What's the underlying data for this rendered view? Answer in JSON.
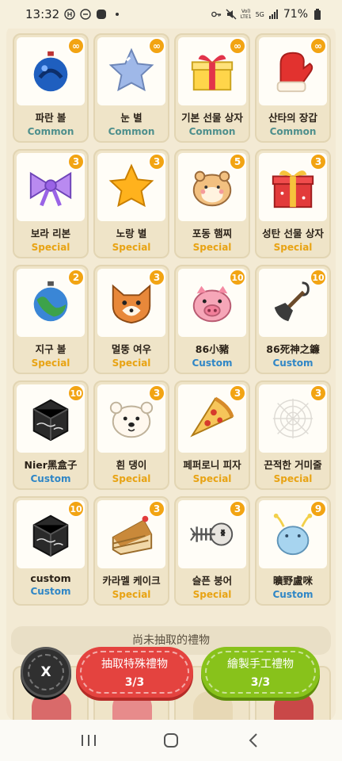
{
  "status": {
    "time": "13:32",
    "battery": "71%",
    "net_a": "Vol)",
    "net_b": "LTE1",
    "net_c": "5G"
  },
  "items": [
    {
      "name": "파란 볼",
      "rarity": "Common",
      "count": "∞",
      "icon": "blue-ornament-icon"
    },
    {
      "name": "눈 별",
      "rarity": "Common",
      "count": "∞",
      "icon": "snow-star-icon"
    },
    {
      "name": "기본 선물 상자",
      "rarity": "Common",
      "count": "∞",
      "icon": "gift-box-icon"
    },
    {
      "name": "산타의 장갑",
      "rarity": "Common",
      "count": "∞",
      "icon": "mitten-icon"
    },
    {
      "name": "보라 리본",
      "rarity": "Special",
      "count": "3",
      "icon": "purple-ribbon-icon"
    },
    {
      "name": "노랑 별",
      "rarity": "Special",
      "count": "3",
      "icon": "yellow-star-icon"
    },
    {
      "name": "포동 햄찌",
      "rarity": "Special",
      "count": "5",
      "icon": "hamster-icon"
    },
    {
      "name": "성탄 선물 상자",
      "rarity": "Special",
      "count": "3",
      "icon": "christmas-gift-icon"
    },
    {
      "name": "지구 볼",
      "rarity": "Special",
      "count": "2",
      "icon": "earth-ornament-icon"
    },
    {
      "name": "멀뚱 여우",
      "rarity": "Special",
      "count": "3",
      "icon": "fox-icon"
    },
    {
      "name": "86小豬",
      "rarity": "Custom",
      "count": "10",
      "icon": "pig-icon"
    },
    {
      "name": "86死神之鐮",
      "rarity": "Custom",
      "count": "10",
      "icon": "shovel-icon"
    },
    {
      "name": "Nier黑盒子",
      "rarity": "Custom",
      "count": "10",
      "icon": "black-box-icon"
    },
    {
      "name": "흰 댕이",
      "rarity": "Special",
      "count": "3",
      "icon": "white-dog-icon"
    },
    {
      "name": "페퍼로니 피자",
      "rarity": "Special",
      "count": "3",
      "icon": "pizza-icon"
    },
    {
      "name": "끈적한 거미줄",
      "rarity": "Special",
      "count": "3",
      "icon": "spiderweb-icon"
    },
    {
      "name": "custom",
      "rarity": "Custom",
      "count": "10",
      "icon": "black-box-icon"
    },
    {
      "name": "카라멜 케이크",
      "rarity": "Special",
      "count": "3",
      "icon": "caramel-cake-icon"
    },
    {
      "name": "슬픈 붕어",
      "rarity": "Special",
      "count": "3",
      "icon": "fish-bone-icon"
    },
    {
      "name": "曠野盧咪",
      "rarity": "Custom",
      "count": "9",
      "icon": "blue-creature-icon"
    }
  ],
  "section_label": "尚未抽取的禮物",
  "actions": {
    "close_label": "X",
    "draw_label": "抽取特殊禮物",
    "draw_count": "3/3",
    "craft_label": "繪製手工禮物",
    "craft_count": "3/3"
  },
  "colors": {
    "common": "#4e8f8c",
    "special": "#e8a313",
    "custom": "#2f86c6",
    "badge": "#f2a413",
    "draw_button": "#e4433f",
    "craft_button": "#88c21b"
  }
}
